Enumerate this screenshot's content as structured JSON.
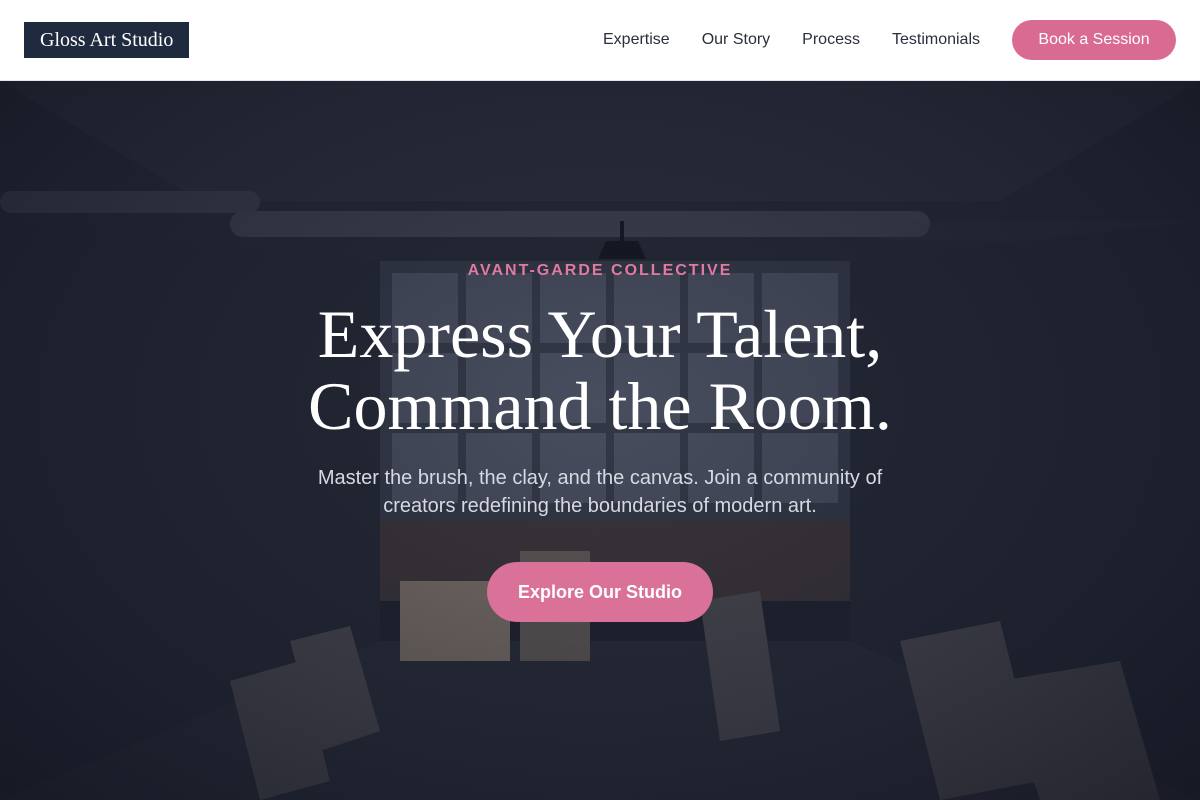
{
  "header": {
    "logo_text": "Gloss Art Studio",
    "nav": [
      {
        "label": "Expertise"
      },
      {
        "label": "Our Story"
      },
      {
        "label": "Process"
      },
      {
        "label": "Testimonials"
      }
    ],
    "cta_label": "Book a Session"
  },
  "hero": {
    "eyebrow": "AVANT-GARDE COLLECTIVE",
    "headline_line1": "Express Your Talent,",
    "headline_line2": "Command the Room.",
    "subtitle": "Master the brush, the clay, and the canvas. Join a community of creators redefining the boundaries of modern art.",
    "cta_label": "Explore Our Studio",
    "background_image": "art-studio-warehouse-interior"
  },
  "colors": {
    "brand_pink": "#d96b92",
    "logo_bg": "#1f2a3f",
    "hero_overlay": "#1c2030"
  }
}
